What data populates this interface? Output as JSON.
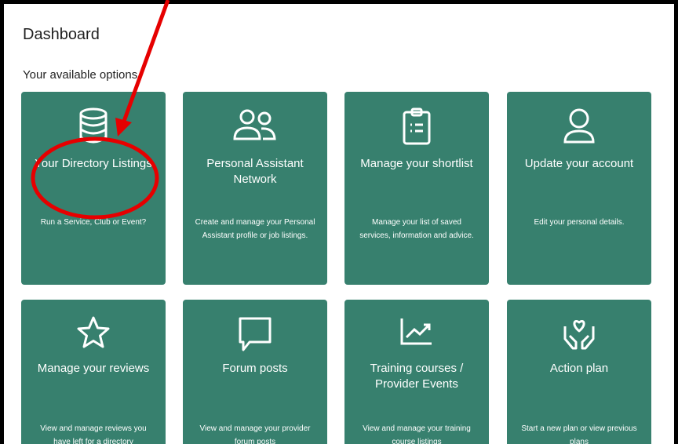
{
  "page": {
    "title": "Dashboard",
    "subtitle": "Your available options"
  },
  "cards": [
    {
      "title": "Your Directory Listings",
      "description": "Run a Service, Club or Event?",
      "icon": "database-icon"
    },
    {
      "title": "Personal Assistant Network",
      "description": "Create and manage your Personal Assistant profile or job listings.",
      "icon": "users-icon"
    },
    {
      "title": "Manage your shortlist",
      "description": "Manage your list of saved services, information and advice.",
      "icon": "clipboard-list-icon"
    },
    {
      "title": "Update your account",
      "description": "Edit your personal details.",
      "icon": "user-icon"
    },
    {
      "title": "Manage your reviews",
      "description": "View and manage reviews you have left for a directory",
      "icon": "star-icon"
    },
    {
      "title": "Forum posts",
      "description": "View and manage your provider forum posts",
      "icon": "speech-bubble-icon"
    },
    {
      "title": "Training courses / Provider Events",
      "description": "View and manage your training course listings",
      "icon": "chart-trend-icon"
    },
    {
      "title": "Action plan",
      "description": "Start a new plan or view previous plans",
      "icon": "hands-heart-icon"
    }
  ],
  "colors": {
    "card_background": "#37806e",
    "annotation_red": "#e60000"
  }
}
